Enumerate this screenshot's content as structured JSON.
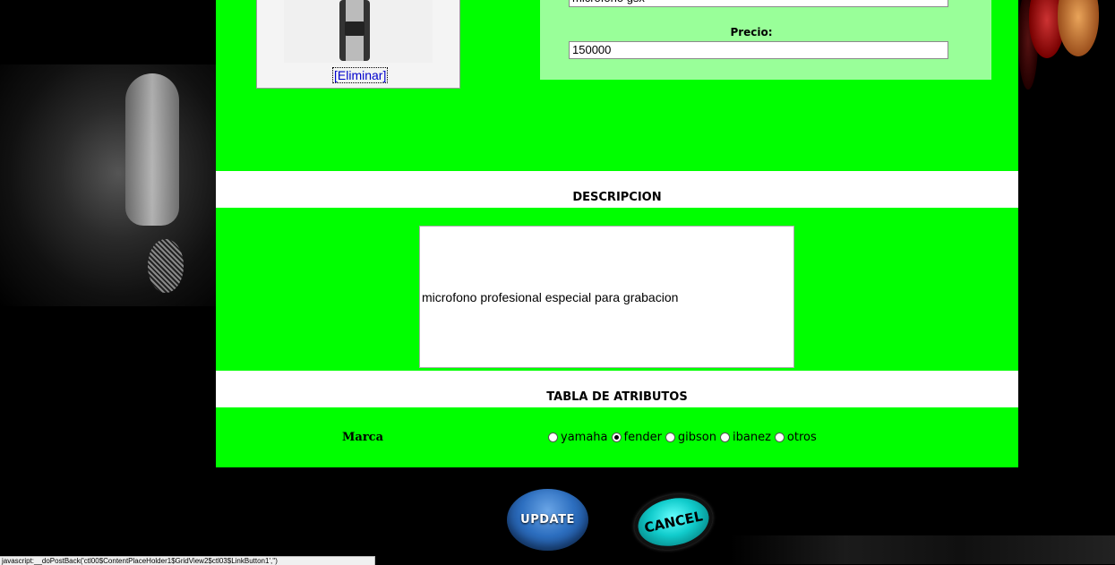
{
  "product": {
    "name_value": "microfono gsx",
    "price_label": "Precio:",
    "price_value": "150000",
    "delete_link": "[Eliminar]"
  },
  "sections": {
    "description_title": "DESCRIPCION",
    "description_text": "microfono profesional especial para grabacion",
    "attributes_title": "TABLA DE ATRIBUTOS"
  },
  "attributes": {
    "brand_label": "Marca",
    "brand_options": [
      "yamaha",
      "fender",
      "gibson",
      "ibanez",
      "otros"
    ],
    "brand_selected": "fender"
  },
  "buttons": {
    "update": "UPDATE",
    "cancel": "CANCEL"
  },
  "status_bar": {
    "text": "javascript:__doPostBack('ctl00$ContentPlaceHolder1$GridView2$ctl03$LinkButton1','')"
  },
  "colors": {
    "green": "#00ff00",
    "light_green": "#99ff99",
    "white": "#ffffff",
    "background": "#000000"
  }
}
